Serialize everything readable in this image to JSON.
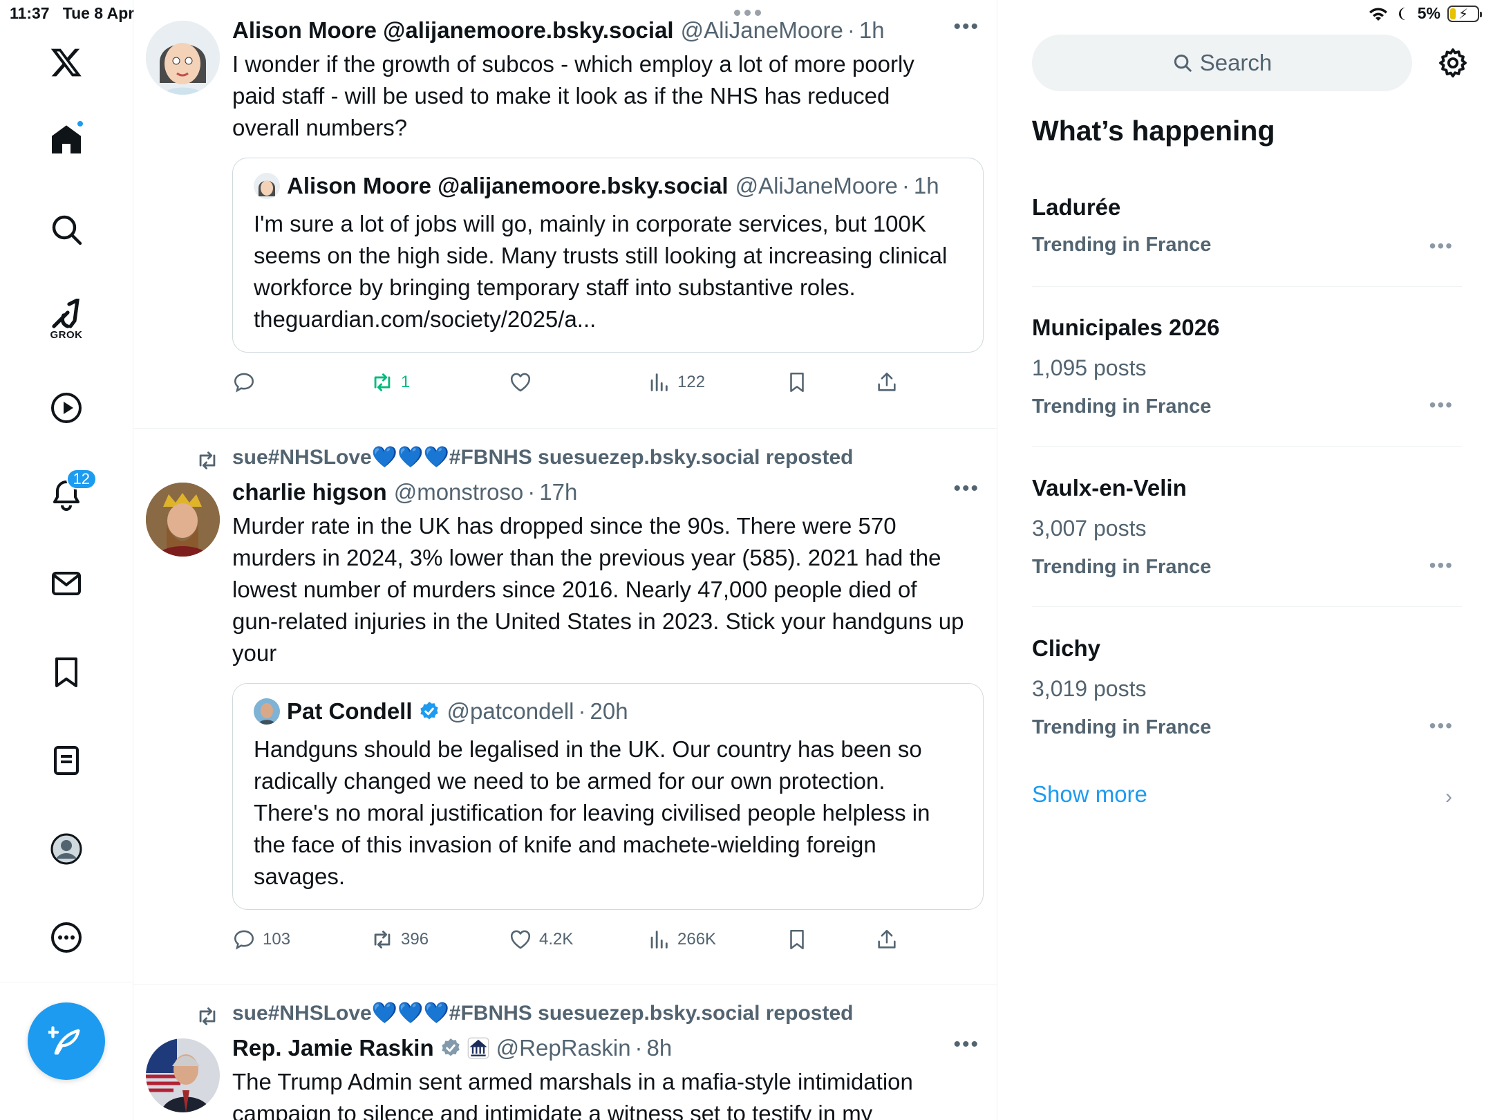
{
  "status_bar": {
    "time": "11:37",
    "date": "Tue 8 Apr",
    "battery": "5%"
  },
  "nav": {
    "grok_label": "GROK",
    "notifications_count": "12"
  },
  "posts": [
    {
      "name": "Alison Moore @alijanemoore.bsky.social",
      "handle": "@AliJaneMoore",
      "time": "1h",
      "text": "I wonder if the growth of subcos - which employ a lot of more poorly paid staff -  will be used to make it look as if the NHS has reduced overall numbers?",
      "quote": {
        "name": "Alison Moore @alijanemoore.bsky.social",
        "handle": "@AliJaneMoore",
        "time": "1h",
        "text": "I'm sure a lot of jobs will go, mainly in corporate services, but 100K seems on the high side.  Many trusts still looking at increasing clinical workforce by bringing temporary staff into substantive roles. theguardian.com/society/2025/a..."
      },
      "actions": {
        "replies": "",
        "reposts": "1",
        "likes": "",
        "views": "122"
      }
    },
    {
      "reposted_by": "sue#NHSLove💙💙💙#FBNHS suesuezep.bsky.social reposted",
      "name": "charlie higson",
      "handle": "@monstroso",
      "time": "17h",
      "text": "Murder rate in the UK has dropped since the 90s. There were 570 murders in 2024, 3% lower than the previous year (585). 2021 had the lowest number of murders since 2016. Nearly 47,000 people died of gun-related injuries in the United States in 2023. Stick your handguns up your",
      "quote": {
        "name": "Pat Condell",
        "handle": "@patcondell",
        "time": "20h",
        "text": "Handguns should be legalised in the UK. Our country has been so radically changed we need to be armed for our own protection. There's no moral justification for leaving civilised people helpless in the face of this invasion of knife and machete-wielding foreign savages."
      },
      "actions": {
        "replies": "103",
        "reposts": "396",
        "likes": "4.2K",
        "views": "266K"
      }
    },
    {
      "reposted_by": "sue#NHSLove💙💙💙#FBNHS suesuezep.bsky.social reposted",
      "name": "Rep. Jamie Raskin",
      "handle": "@RepRaskin",
      "time": "8h",
      "text": "The Trump Admin sent armed marshals in a mafia-style intimidation campaign to silence and intimidate a witness set to testify in my"
    }
  ],
  "sidebar": {
    "search_placeholder": "Search",
    "heading": "What’s happening",
    "trends": [
      {
        "title": "Ladurée",
        "posts": "",
        "location": "Trending in France"
      },
      {
        "title": "Municipales 2026",
        "posts": "1,095 posts",
        "location": "Trending in France"
      },
      {
        "title": "Vaulx-en-Velin",
        "posts": "3,007 posts",
        "location": "Trending in France"
      },
      {
        "title": "Clichy",
        "posts": "3,019 posts",
        "location": "Trending in France"
      }
    ],
    "show_more": "Show more"
  },
  "colors": {
    "accent": "#1d9bf0",
    "repost_green": "#00ba7c",
    "muted": "#536471"
  }
}
